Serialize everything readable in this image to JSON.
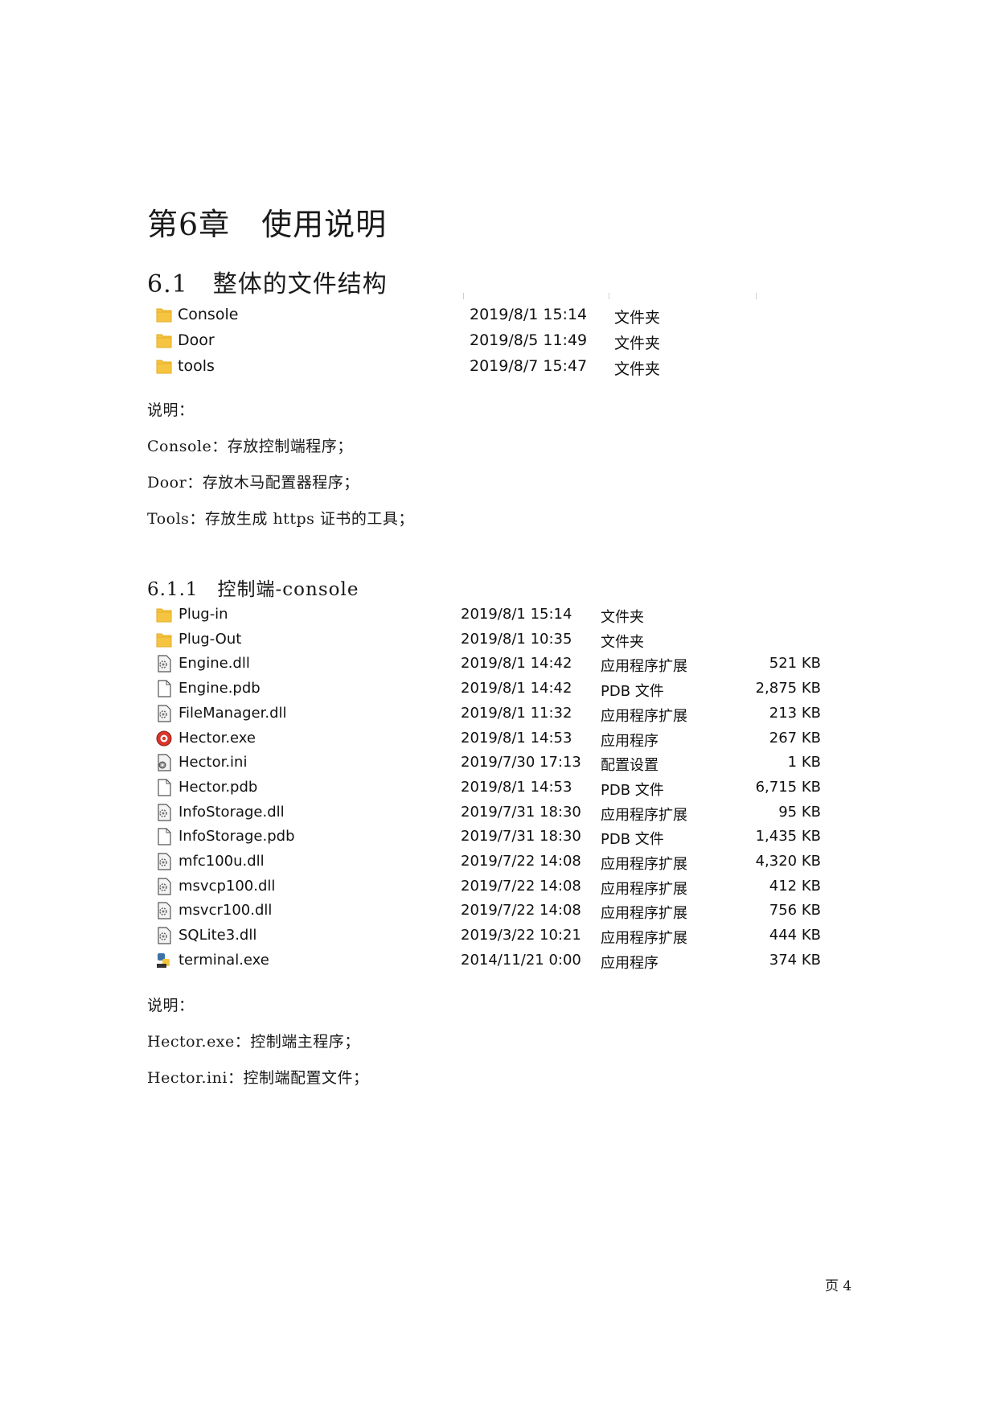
{
  "chapter_title": "第6章　使用说明",
  "section_title": "6.1　整体的文件结构",
  "top_folders": [
    {
      "name": "Console",
      "date": "2019/8/1 15:14",
      "type": "文件夹",
      "icon": "folder-icon"
    },
    {
      "name": "Door",
      "date": "2019/8/5 11:49",
      "type": "文件夹",
      "icon": "folder-icon"
    },
    {
      "name": "tools",
      "date": "2019/8/7 15:47",
      "type": "文件夹",
      "icon": "folder-icon"
    }
  ],
  "notes1": [
    "说明：",
    "Console：存放控制端程序；",
    "Door：存放木马配置器程序；",
    "Tools：存放生成 https 证书的工具；"
  ],
  "subsection_title": "6.1.1　控制端-console",
  "console_files": [
    {
      "name": "Plug-in",
      "date": "2019/8/1 15:14",
      "type": "文件夹",
      "size": "",
      "icon": "folder-icon"
    },
    {
      "name": "Plug-Out",
      "date": "2019/8/1 10:35",
      "type": "文件夹",
      "size": "",
      "icon": "folder-icon"
    },
    {
      "name": "Engine.dll",
      "date": "2019/8/1 14:42",
      "type": "应用程序扩展",
      "size": "521 KB",
      "icon": "dll-icon"
    },
    {
      "name": "Engine.pdb",
      "date": "2019/8/1 14:42",
      "type": "PDB 文件",
      "size": "2,875 KB",
      "icon": "file-icon"
    },
    {
      "name": "FileManager.dll",
      "date": "2019/8/1 11:32",
      "type": "应用程序扩展",
      "size": "213 KB",
      "icon": "dll-icon"
    },
    {
      "name": "Hector.exe",
      "date": "2019/8/1 14:53",
      "type": "应用程序",
      "size": "267 KB",
      "icon": "app-icon"
    },
    {
      "name": "Hector.ini",
      "date": "2019/7/30 17:13",
      "type": "配置设置",
      "size": "1 KB",
      "icon": "ini-icon"
    },
    {
      "name": "Hector.pdb",
      "date": "2019/8/1 14:53",
      "type": "PDB 文件",
      "size": "6,715 KB",
      "icon": "file-icon"
    },
    {
      "name": "InfoStorage.dll",
      "date": "2019/7/31 18:30",
      "type": "应用程序扩展",
      "size": "95 KB",
      "icon": "dll-icon"
    },
    {
      "name": "InfoStorage.pdb",
      "date": "2019/7/31 18:30",
      "type": "PDB 文件",
      "size": "1,435 KB",
      "icon": "file-icon"
    },
    {
      "name": "mfc100u.dll",
      "date": "2019/7/22 14:08",
      "type": "应用程序扩展",
      "size": "4,320 KB",
      "icon": "dll-icon"
    },
    {
      "name": "msvcp100.dll",
      "date": "2019/7/22 14:08",
      "type": "应用程序扩展",
      "size": "412 KB",
      "icon": "dll-icon"
    },
    {
      "name": "msvcr100.dll",
      "date": "2019/7/22 14:08",
      "type": "应用程序扩展",
      "size": "756 KB",
      "icon": "dll-icon"
    },
    {
      "name": "SQLite3.dll",
      "date": "2019/3/22 10:21",
      "type": "应用程序扩展",
      "size": "444 KB",
      "icon": "dll-icon"
    },
    {
      "name": "terminal.exe",
      "date": "2014/11/21 0:00",
      "type": "应用程序",
      "size": "374 KB",
      "icon": "python-exe-icon"
    }
  ],
  "notes2": [
    "说明：",
    "Hector.exe：控制端主程序；",
    "Hector.ini：控制端配置文件；"
  ],
  "page_number": "页 4",
  "colors": {
    "folder": "#f5c542",
    "folder_dark": "#e3a81c",
    "app_red": "#d9352b"
  }
}
